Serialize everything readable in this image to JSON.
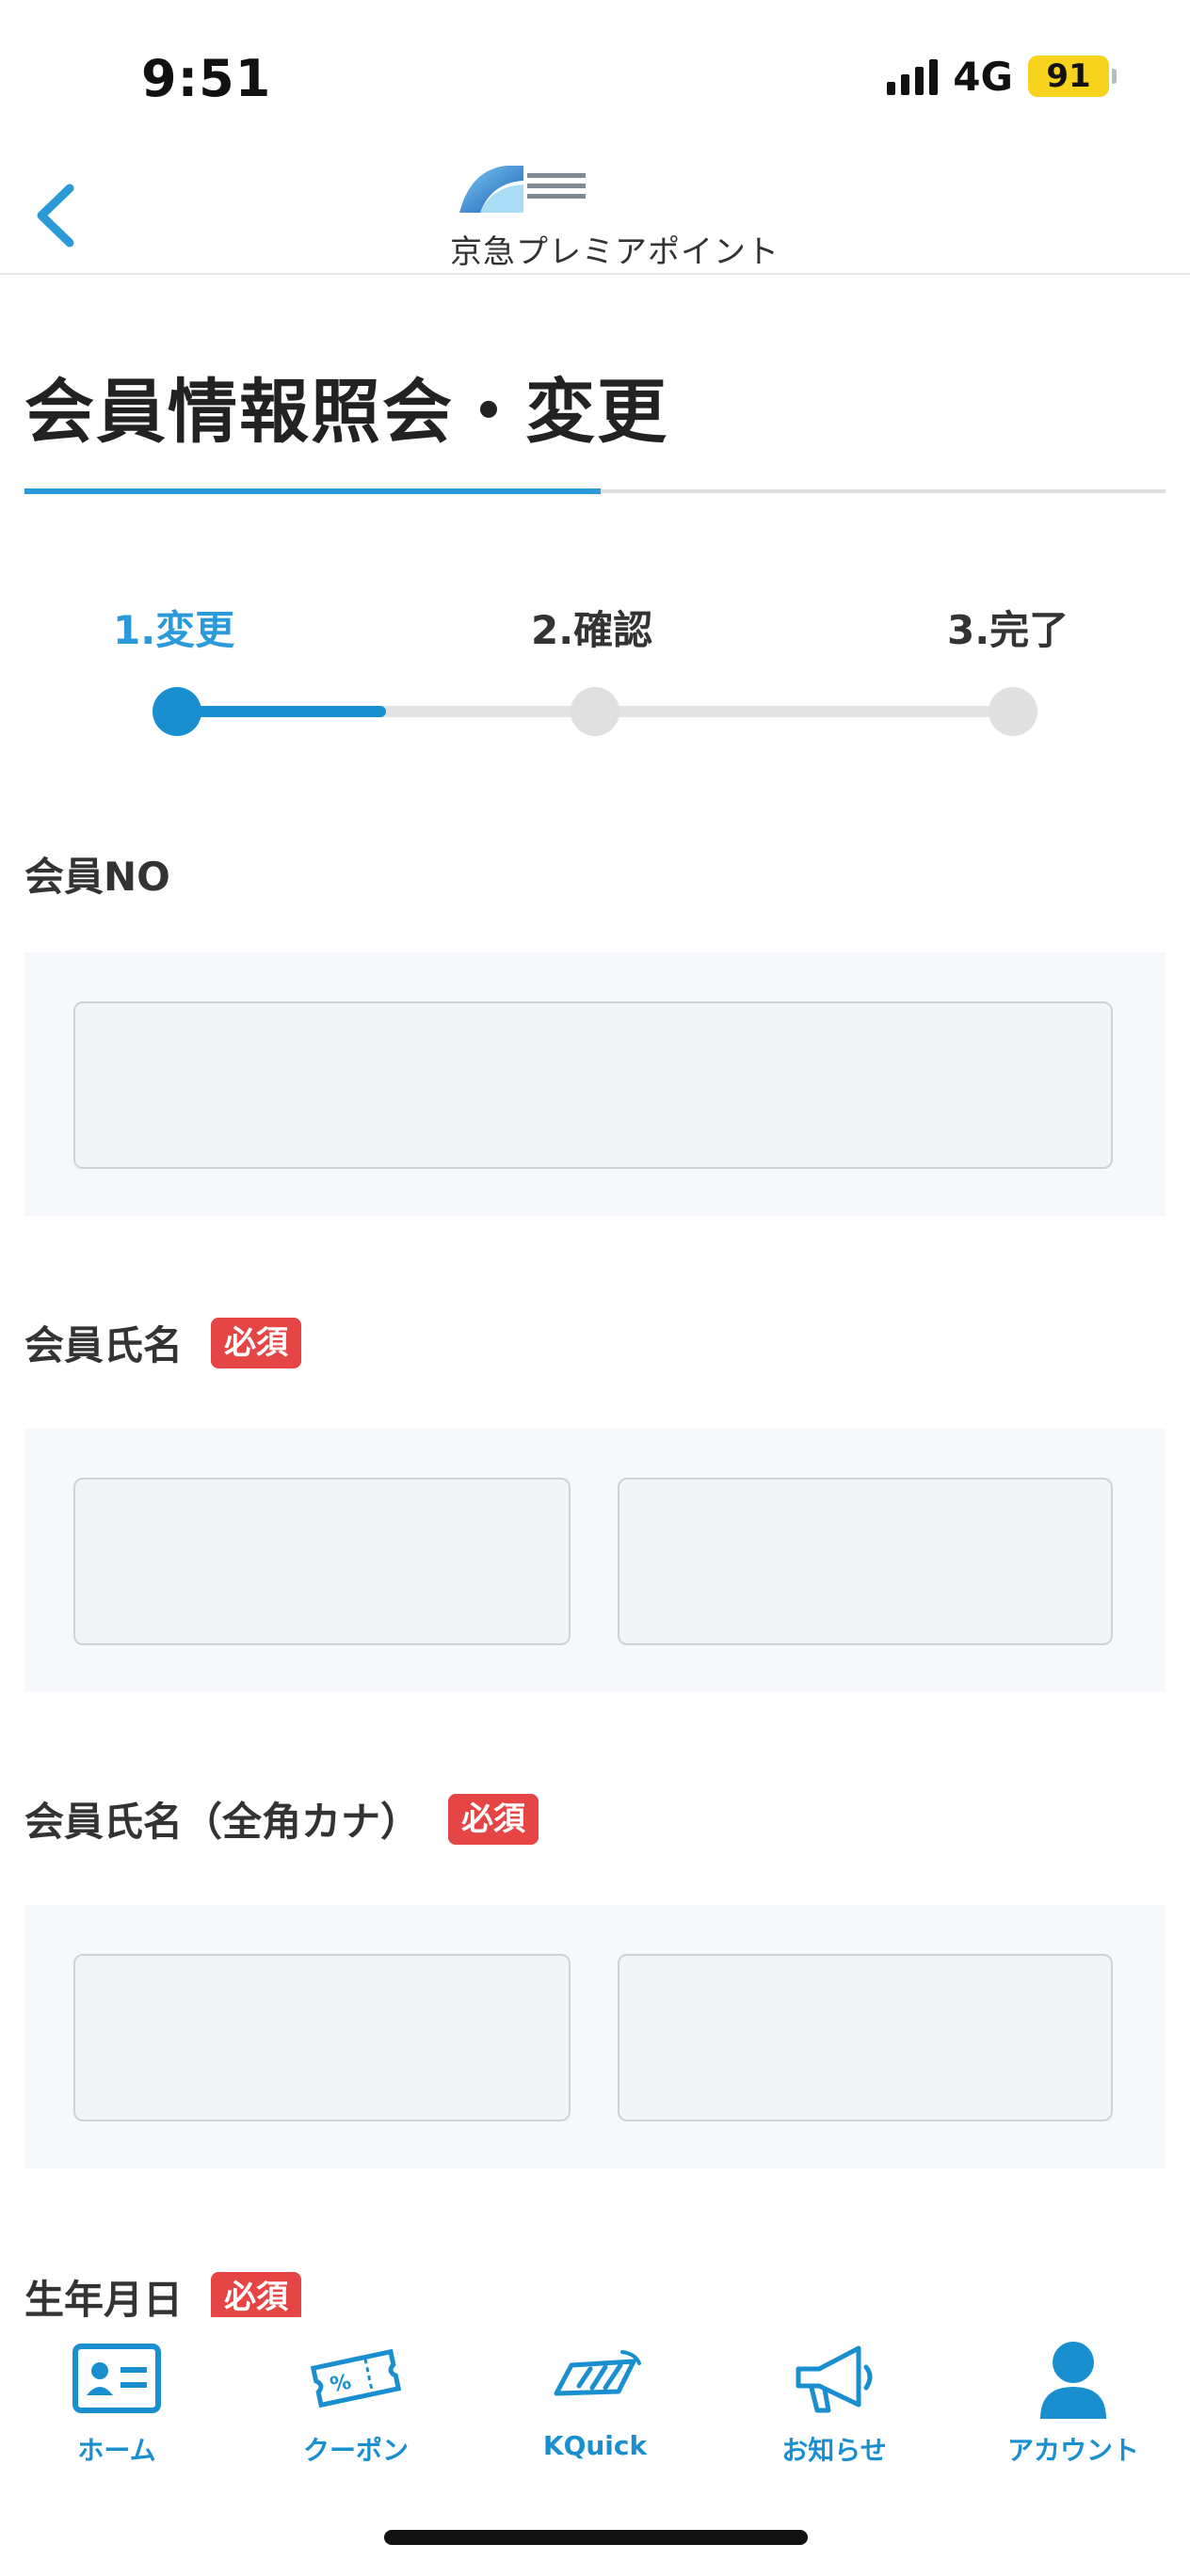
{
  "status_bar": {
    "time": "9:51",
    "network": "4G",
    "battery": "91"
  },
  "header": {
    "back_icon": "chevron-left-icon",
    "logo_text": "京急プレミアポイント",
    "accent_color": "#2a9ad8"
  },
  "page": {
    "title": "会員情報照会・変更"
  },
  "stepper": {
    "current_step": 1,
    "steps": [
      {
        "label": "1.変更"
      },
      {
        "label": "2.確認"
      },
      {
        "label": "3.完了"
      }
    ]
  },
  "form": {
    "required_badge": "必須",
    "required_color": "#e64545",
    "fields": [
      {
        "label": "会員NO",
        "required": false,
        "values": [
          ""
        ]
      },
      {
        "label": "会員氏名",
        "required": true,
        "values": [
          "",
          ""
        ]
      },
      {
        "label": "会員氏名（全角カナ）",
        "required": true,
        "values": [
          "",
          ""
        ]
      },
      {
        "label": "生年月日",
        "required": true
      }
    ]
  },
  "tab_bar": {
    "items": [
      {
        "label": "ホーム",
        "icon": "member-card-icon"
      },
      {
        "label": "クーポン",
        "icon": "coupon-ticket-icon"
      },
      {
        "label": "KQuick",
        "icon": "kquick-pass-icon"
      },
      {
        "label": "お知らせ",
        "icon": "megaphone-icon"
      },
      {
        "label": "アカウント",
        "icon": "account-person-icon"
      }
    ]
  }
}
